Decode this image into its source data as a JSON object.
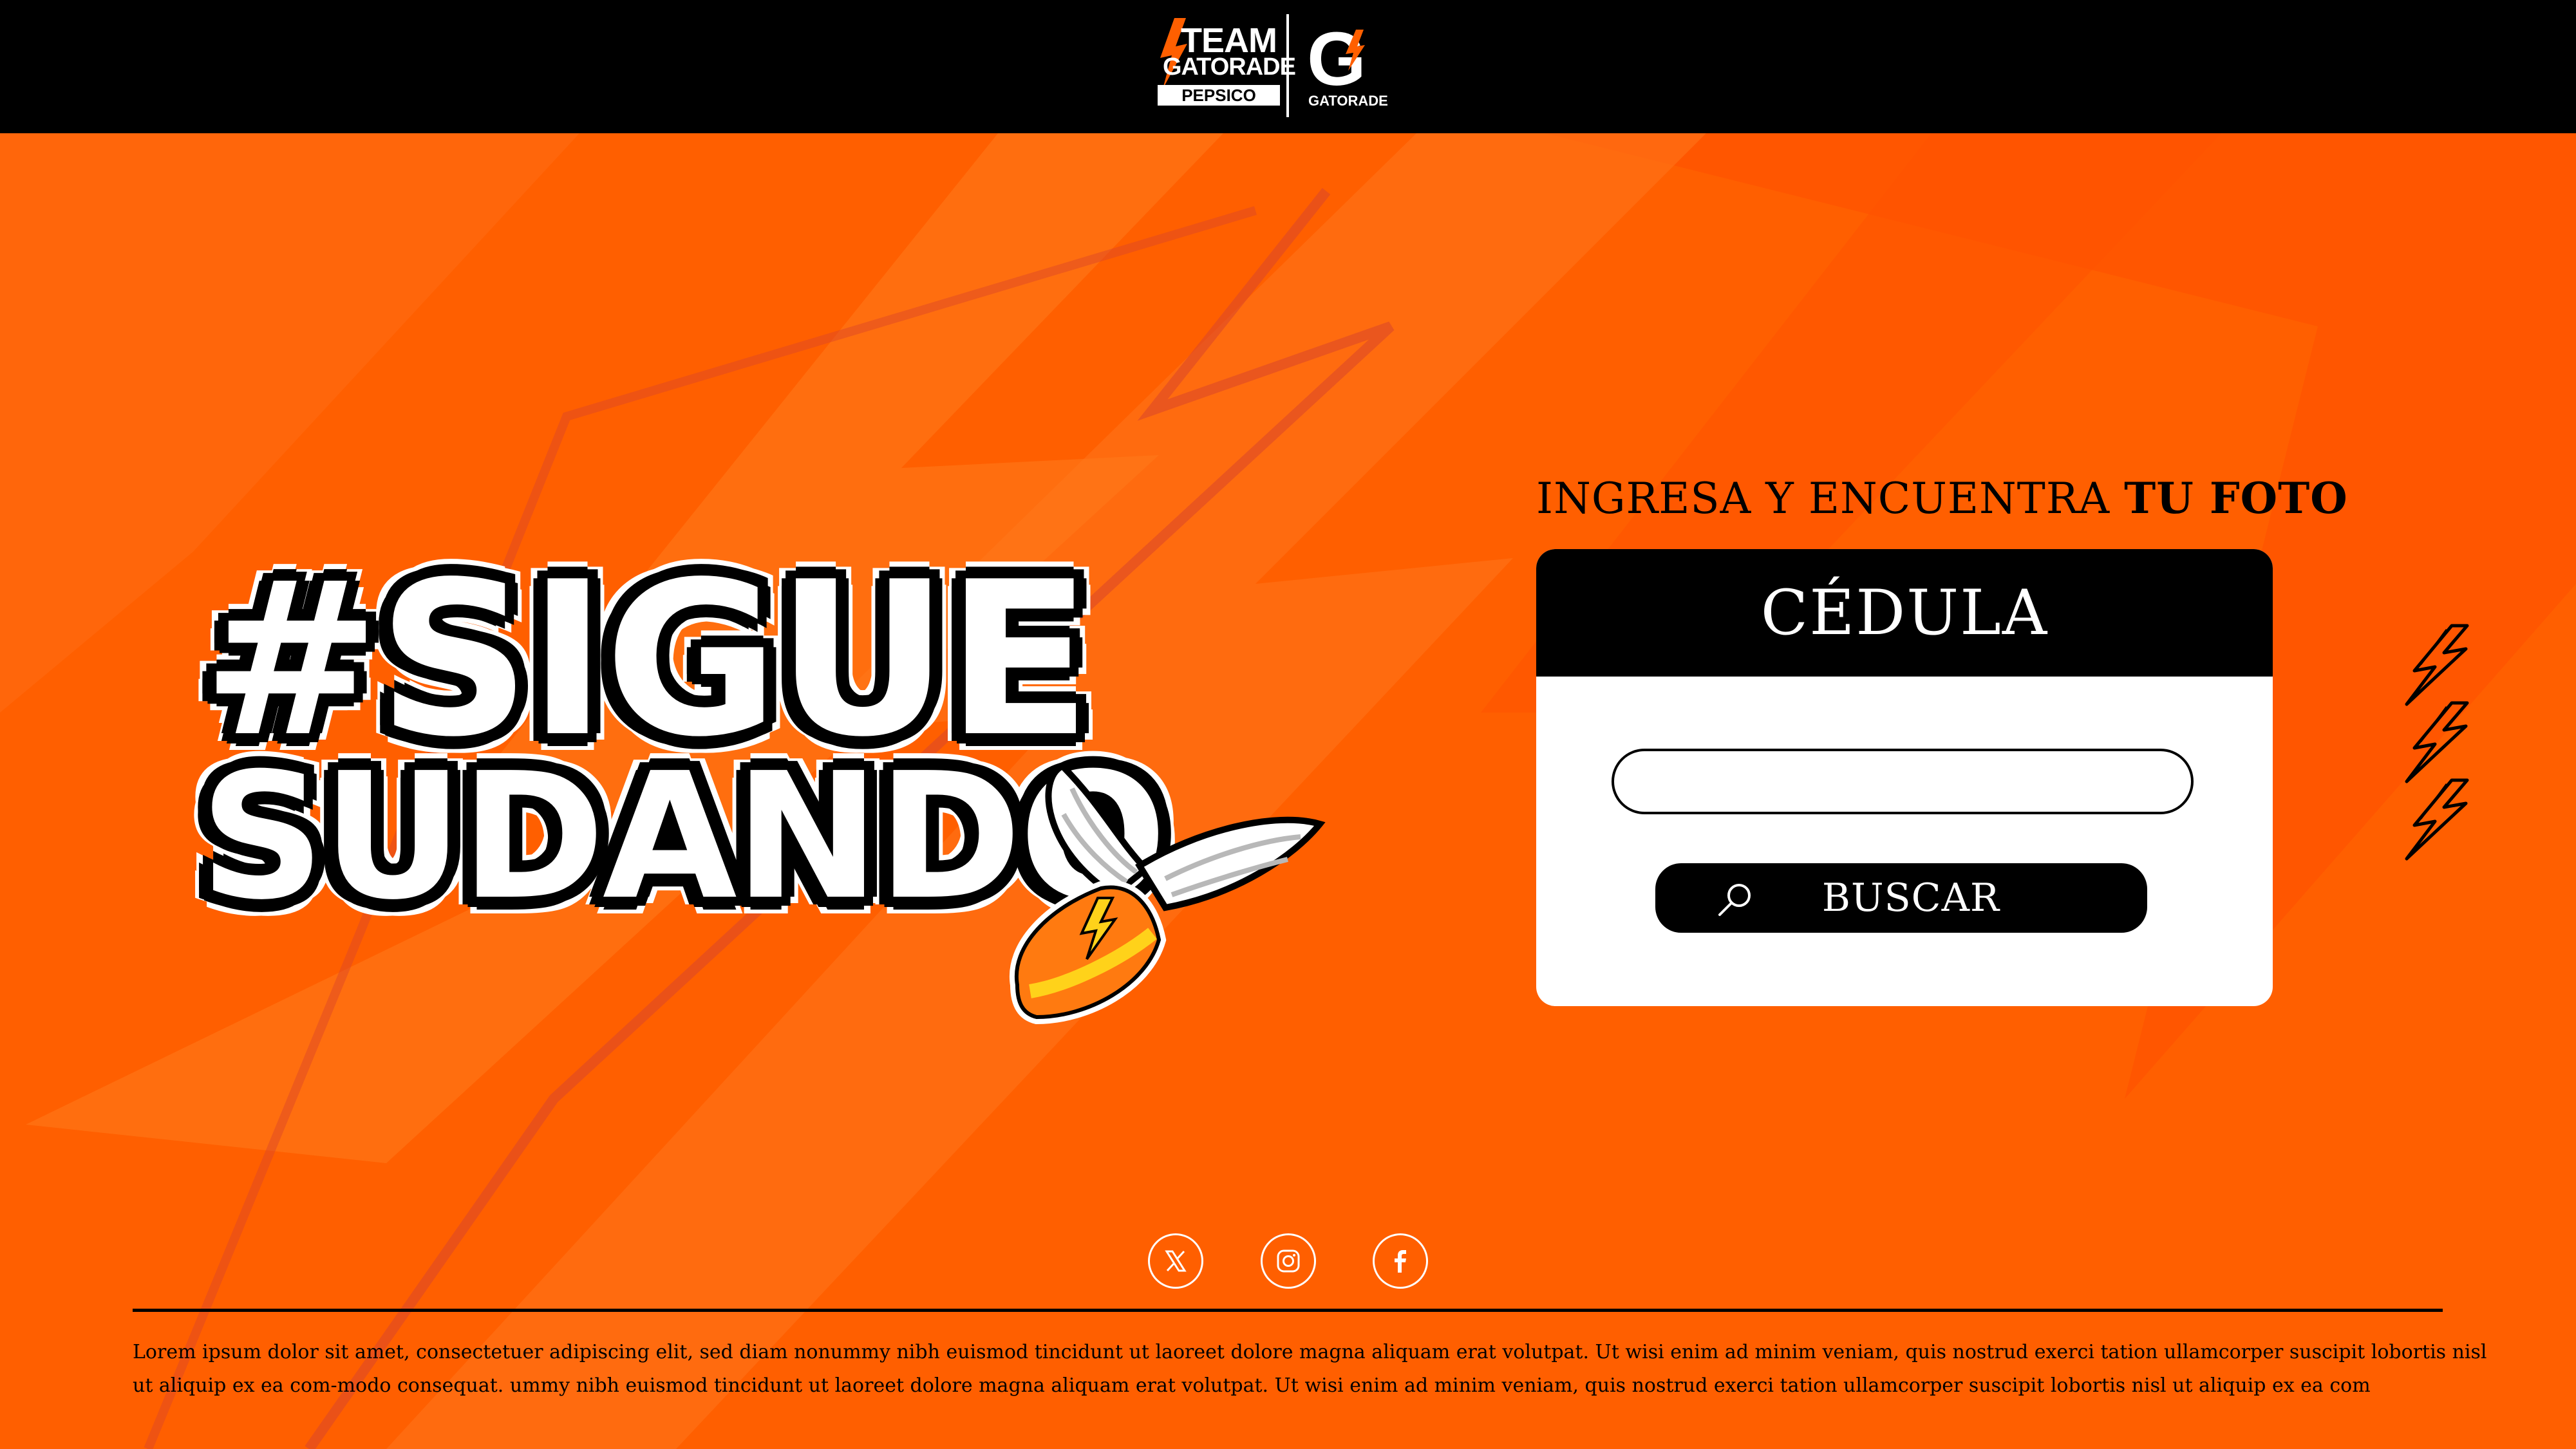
{
  "header": {
    "brand": {
      "team_word": "TEAM",
      "gatorade_word": "GATORADE",
      "pepsico_word": "PEPSICO",
      "g_letter": "G",
      "g_caption": "GATORADE"
    }
  },
  "hero": {
    "line1": "#SIGUE",
    "line2": "SUDANDO"
  },
  "form": {
    "heading_prefix": "INGRESA Y ENCUENTRA ",
    "heading_emphasis": "TU FOTO",
    "card_title": "CÉDULA",
    "input_value": "",
    "input_placeholder": "",
    "button_label": "BUSCAR",
    "button_icon": "search-icon"
  },
  "decor": {
    "side_icons": [
      "bolt-icon",
      "bolt-icon",
      "bolt-icon"
    ]
  },
  "social": [
    {
      "name": "x-icon"
    },
    {
      "name": "instagram-icon"
    },
    {
      "name": "facebook-icon"
    }
  ],
  "footer": {
    "legal_text": "Lorem ipsum dolor sit amet, consectetuer adipiscing elit, sed diam nonummy nibh euismod tincidunt ut laoreet dolore magna aliquam erat volutpat. Ut wisi enim ad minim veniam, quis nostrud exerci tation ullamcorper suscipit lobortis nisl ut aliquip ex ea com-modo consequat. ummy nibh euismod tincidunt ut laoreet dolore magna aliquam erat volutpat. Ut wisi enim ad minim veniam, quis nostrud exerci tation ullamcorper suscipit lobortis nisl ut aliquip ex ea com"
  },
  "colors": {
    "brand_orange": "#ff5f00",
    "black": "#000000",
    "white": "#ffffff"
  }
}
